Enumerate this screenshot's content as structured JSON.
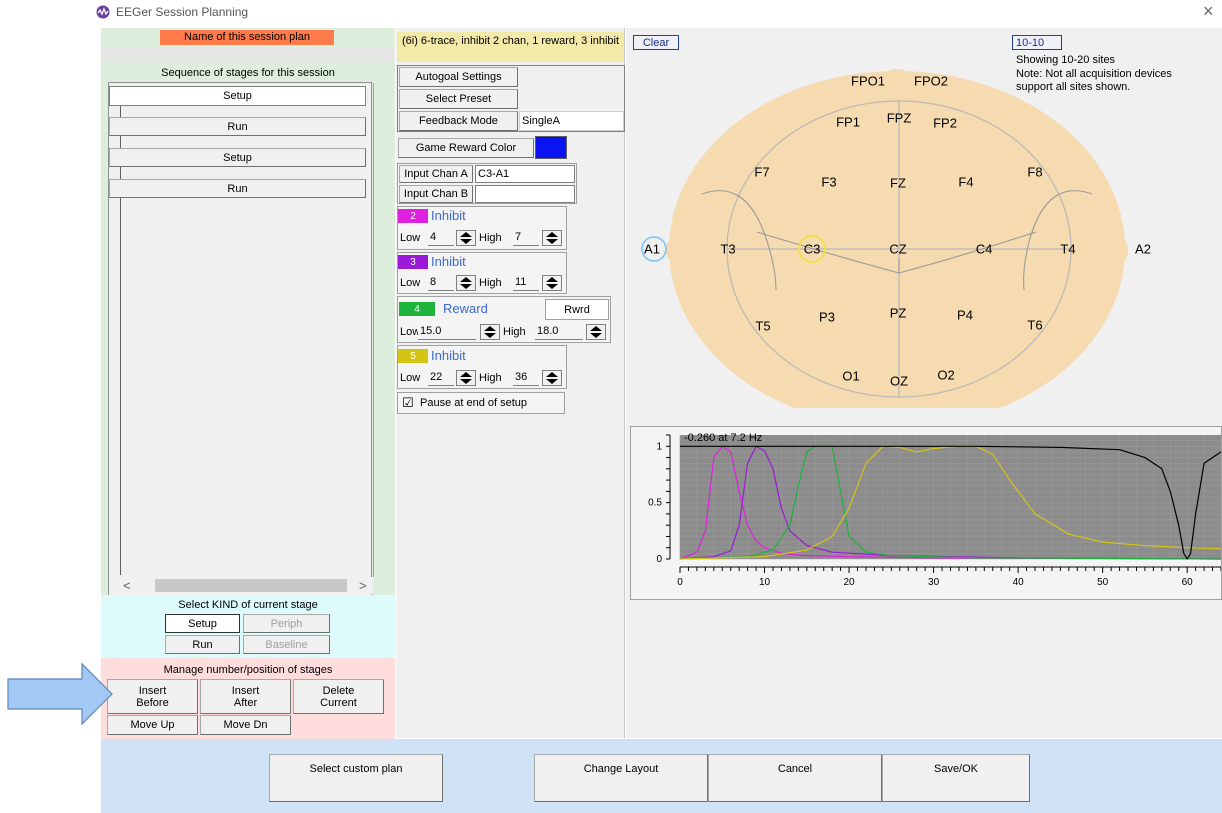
{
  "window": {
    "title": "EEGer Session Planning",
    "close": "×"
  },
  "left": {
    "plan_name_label": "Name of this session plan",
    "sequence_label": "Sequence of stages for this session",
    "stages": [
      "Setup",
      "Run",
      "Setup",
      "Run"
    ],
    "scroll_left": "<",
    "scroll_right": ">",
    "kind_label": "Select KIND of current stage",
    "kind_buttons": {
      "setup": "Setup",
      "periph": "Periph",
      "run": "Run",
      "baseline": "Baseline"
    },
    "manage_label": "Manage number/position of stages",
    "manage_buttons": {
      "insert_before_1": "Insert",
      "insert_before_2": "Before",
      "insert_after_1": "Insert",
      "insert_after_2": "After",
      "delete_1": "Delete",
      "delete_2": "Current",
      "move_up": "Move Up",
      "move_dn": "Move Dn"
    }
  },
  "middle": {
    "protocol_title": "(6i) 6-trace, inhibit 2 chan, 1 reward, 3 inhibit",
    "autogoal": "Autogoal Settings",
    "select_preset": "Select Preset",
    "feedback_mode_label": "Feedback Mode",
    "feedback_mode_value": "SingleA",
    "game_reward_color": "Game Reward Color",
    "game_reward_color_hex": "#0a14f0",
    "input_chan_a_label": "Input Chan A",
    "input_chan_a_value": "C3-A1",
    "input_chan_b_label": "Input Chan B",
    "input_chan_b_value": "",
    "low_label": "Low",
    "high_label": "High",
    "bands": [
      {
        "num": "2",
        "type": "Inhibit",
        "low": "4",
        "high": "7",
        "color": "#e020e0"
      },
      {
        "num": "3",
        "type": "Inhibit",
        "low": "8",
        "high": "11",
        "color": "#9a1ad8"
      },
      {
        "num": "4",
        "type": "Reward",
        "low": "15.0",
        "high": "18.0",
        "color": "#1eb43c",
        "rwrd": "Rwrd"
      },
      {
        "num": "5",
        "type": "Inhibit",
        "low": "22",
        "high": "36",
        "color": "#d4c414"
      }
    ],
    "pause_checkbox": "☑",
    "pause_label": "Pause at end of setup"
  },
  "head": {
    "clear": "Clear",
    "system": "10-10",
    "showing": "Showing 10-20 sites",
    "note_1": "Note: Not all acquisition devices",
    "note_2": "support all sites shown.",
    "sites": {
      "FPO1": "FPO1",
      "FPO2": "FPO2",
      "FP1": "FP1",
      "FPZ": "FPZ",
      "FP2": "FP2",
      "F7": "F7",
      "F3": "F3",
      "FZ": "FZ",
      "F4": "F4",
      "F8": "F8",
      "A1": "A1",
      "T3": "T3",
      "C3": "C3",
      "CZ": "CZ",
      "C4": "C4",
      "T4": "T4",
      "A2": "A2",
      "T5": "T5",
      "P3": "P3",
      "PZ": "PZ",
      "P4": "P4",
      "T6": "T6",
      "O1": "O1",
      "OZ": "OZ",
      "O2": "O2"
    },
    "selected_sites": [
      "C3",
      "A1"
    ]
  },
  "chart_data": {
    "type": "line",
    "readout": "-0.260 at  7.2 Hz",
    "xlim": [
      0,
      64
    ],
    "ylim": [
      0,
      1.1
    ],
    "xticks": [
      0,
      10,
      20,
      30,
      40,
      50,
      60
    ],
    "yticks": [
      0,
      0.5,
      1
    ],
    "grid": true,
    "series": [
      {
        "color": "#e020e0",
        "x": [
          0,
          2,
          3,
          4,
          5,
          6,
          7,
          8,
          9,
          10,
          12,
          15,
          20,
          30,
          64
        ],
        "y": [
          0.0,
          0.06,
          0.25,
          0.9,
          1.0,
          0.95,
          0.6,
          0.3,
          0.16,
          0.1,
          0.05,
          0.03,
          0.02,
          0.01,
          0.0
        ]
      },
      {
        "color": "#9a1ad8",
        "x": [
          0,
          4,
          6,
          7,
          8,
          9,
          10,
          11,
          12,
          13,
          15,
          18,
          25,
          40,
          64
        ],
        "y": [
          0.0,
          0.02,
          0.07,
          0.3,
          0.85,
          1.0,
          0.96,
          0.8,
          0.45,
          0.25,
          0.12,
          0.06,
          0.03,
          0.01,
          0.0
        ]
      },
      {
        "color": "#1eb43c",
        "x": [
          0,
          8,
          11,
          13,
          14,
          15,
          16,
          18,
          19,
          20,
          22,
          25,
          35,
          64
        ],
        "y": [
          0.0,
          0.02,
          0.08,
          0.3,
          0.65,
          0.95,
          1.0,
          1.0,
          0.6,
          0.2,
          0.06,
          0.03,
          0.01,
          0.0
        ]
      },
      {
        "color": "#d4c414",
        "x": [
          0,
          10,
          15,
          18,
          20,
          22,
          24,
          26,
          28,
          30,
          33,
          35,
          37,
          39,
          42,
          46,
          50,
          55,
          60,
          64
        ],
        "y": [
          0.0,
          0.02,
          0.08,
          0.2,
          0.45,
          0.85,
          1.0,
          0.99,
          0.95,
          0.98,
          1.0,
          1.0,
          0.93,
          0.7,
          0.4,
          0.22,
          0.15,
          0.12,
          0.1,
          0.09
        ]
      },
      {
        "color": "#000000",
        "x": [
          0,
          20,
          35,
          45,
          52,
          55,
          57,
          58,
          59,
          59.6,
          60,
          60.4,
          61,
          62,
          64
        ],
        "y": [
          1.0,
          1.0,
          1.0,
          0.99,
          0.97,
          0.9,
          0.8,
          0.6,
          0.3,
          0.05,
          0.0,
          0.05,
          0.4,
          0.85,
          0.95
        ]
      }
    ]
  },
  "footer": {
    "select_custom_plan": "Select custom plan",
    "change_layout": "Change Layout",
    "cancel": "Cancel",
    "save_ok": "Save/OK"
  }
}
